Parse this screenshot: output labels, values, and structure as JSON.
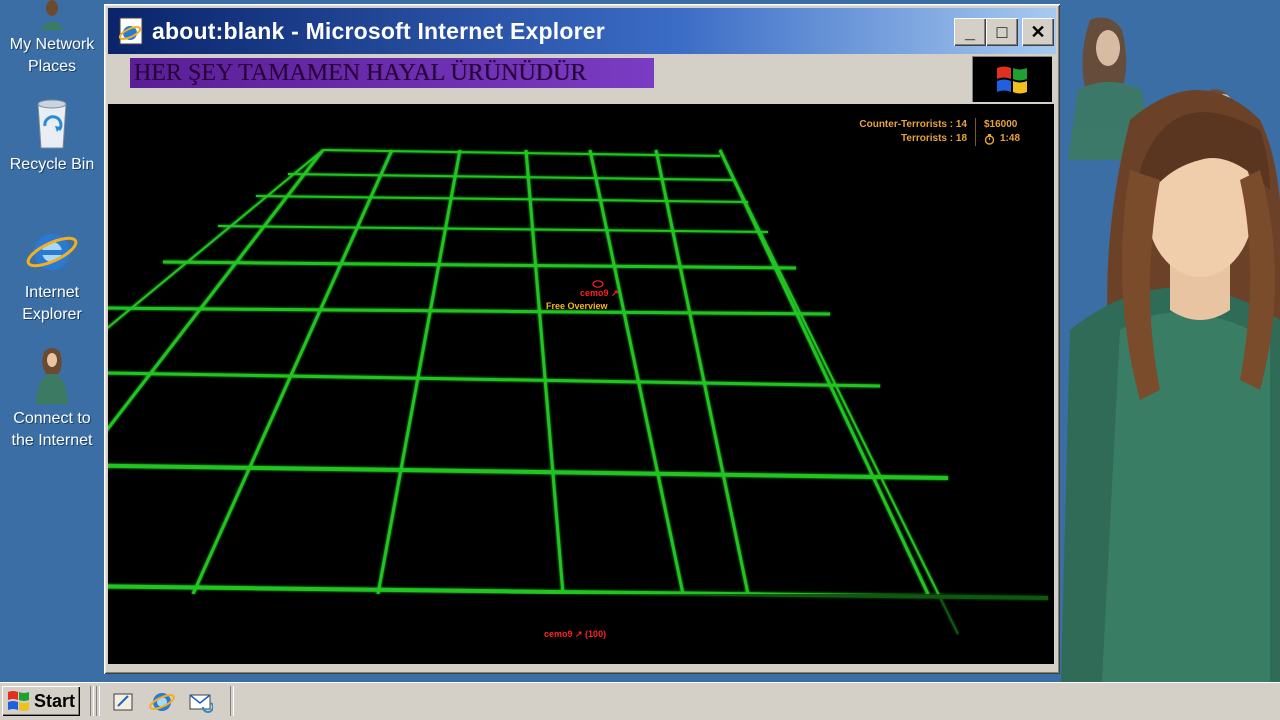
{
  "desktop": {
    "icons": [
      {
        "label_line1": "My Network",
        "label_line2": "Places",
        "icon": "network-places-icon"
      },
      {
        "label_line1": "Recycle Bin",
        "label_line2": "",
        "icon": "recycle-bin-icon"
      },
      {
        "label_line1": "Internet",
        "label_line2": "Explorer",
        "icon": "internet-explorer-icon"
      },
      {
        "label_line1": "Connect to",
        "label_line2": "the Internet",
        "icon": "connect-internet-icon"
      }
    ]
  },
  "window": {
    "title": "about:blank - Microsoft Internet Explorer",
    "minimize_label": "_",
    "maximize_label": "□",
    "close_label": "✕",
    "banner_text": "HER ŞEY TAMAMEN HAYAL ÜRÜNÜDÜR"
  },
  "game": {
    "hud": {
      "ct_label": "Counter-Terrorists : 14",
      "t_label": "Terrorists : 18",
      "money": "$16000",
      "timer": "1:48"
    },
    "player_name": "cemo9 ↗",
    "mode_label": "Free Overview",
    "player_health": "cemo9 ↗ (100)",
    "grid_color": "#22c422"
  },
  "taskbar": {
    "start_label": "Start",
    "quick_launch": [
      "show-desktop-icon",
      "internet-explorer-icon",
      "outlook-express-icon"
    ]
  }
}
